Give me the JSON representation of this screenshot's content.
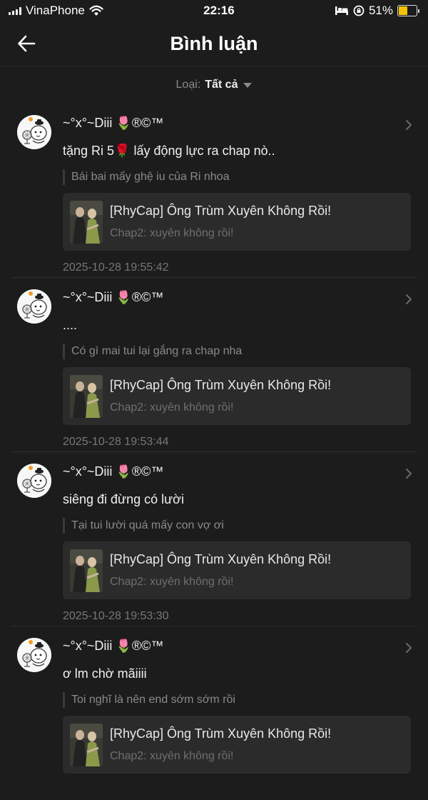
{
  "status_bar": {
    "carrier": "VinaPhone",
    "time": "22:16",
    "battery_percent": "51%",
    "battery_level": 0.51
  },
  "header": {
    "title": "Bình luận"
  },
  "filter": {
    "label": "Loại:",
    "value": "Tất cả"
  },
  "comments": [
    {
      "username": "~°x°~Diii 🌷®©™",
      "text": "tặng Ri 5🌹 lấy động lực ra chap nò..",
      "reply": "Bái bai mấy ghệ iu của Ri nhoa",
      "manga_title": "[RhyCap] Ông Trùm Xuyên Không Rồi!",
      "chapter": "Chap2: xuyên không rồi!",
      "timestamp": "2025-10-28 19:55:42"
    },
    {
      "username": "~°x°~Diii 🌷®©™",
      "text": "....",
      "reply": "Có gì mai tui lại gắng ra chap nha",
      "manga_title": "[RhyCap] Ông Trùm Xuyên Không Rồi!",
      "chapter": "Chap2: xuyên không rồi!",
      "timestamp": "2025-10-28 19:53:44"
    },
    {
      "username": "~°x°~Diii 🌷®©™",
      "text": "siêng đi đừng có lười",
      "reply": "Tại tui lười quá mấy con vợ ơi",
      "manga_title": "[RhyCap] Ông Trùm Xuyên Không Rồi!",
      "chapter": "Chap2: xuyên không rồi!",
      "timestamp": "2025-10-28 19:53:30"
    },
    {
      "username": "~°x°~Diii 🌷®©™",
      "text": "ơ lm chờ mãiiii",
      "reply": "Toi nghĩ là nên end sớm sớm rồi",
      "manga_title": "[RhyCap] Ông Trùm Xuyên Không Rồi!",
      "chapter": "Chap2: xuyên không rồi!",
      "timestamp": ""
    }
  ],
  "colors": {
    "background": "#1c1c1c",
    "card": "#2b2b2b",
    "battery": "#f5c400"
  }
}
